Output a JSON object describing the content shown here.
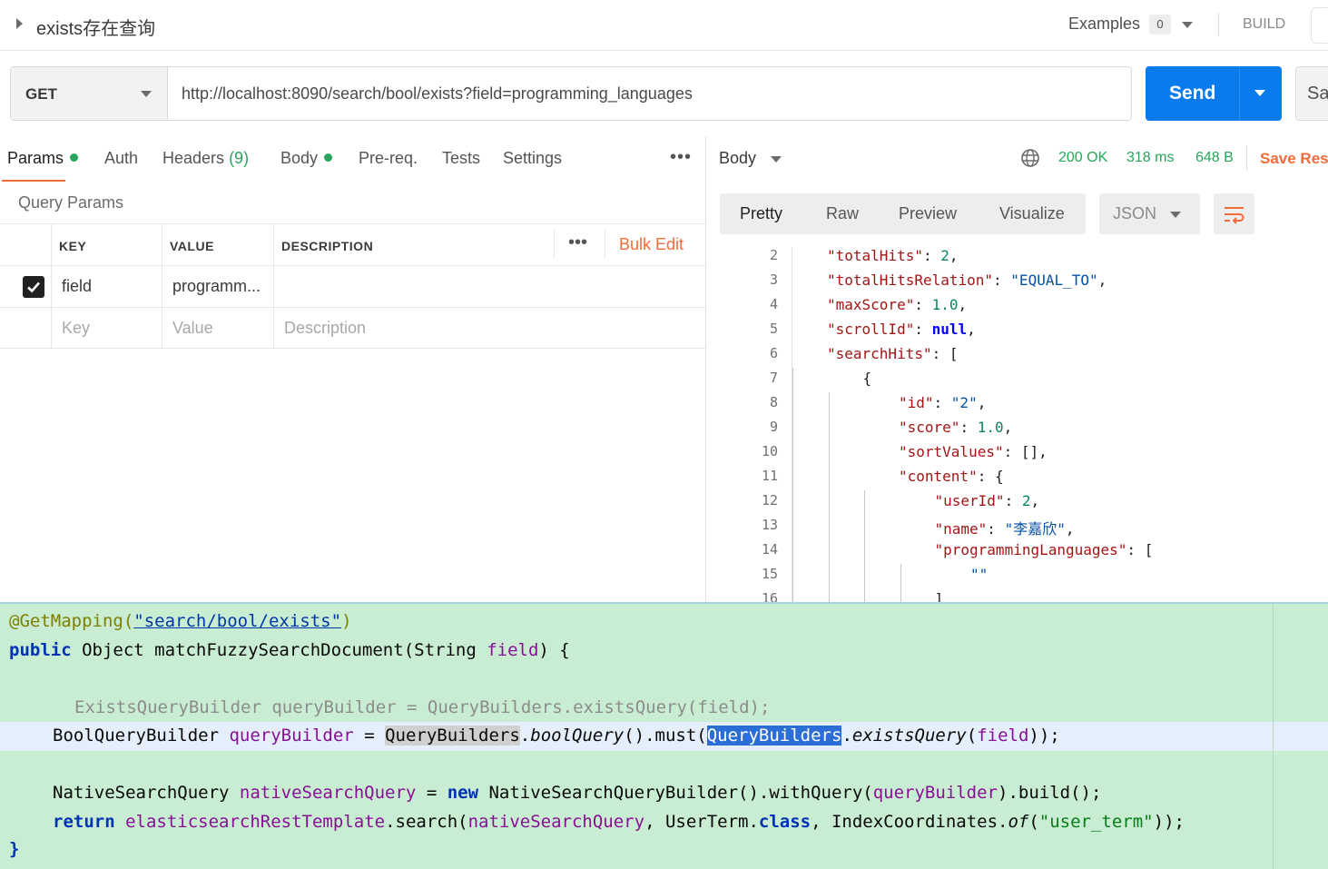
{
  "titlebar": {
    "request_name": "exists存在查询",
    "examples_label": "Examples",
    "examples_count": "0",
    "build_label": "BUILD"
  },
  "request": {
    "method": "GET",
    "url": "http://localhost:8090/search/bool/exists?field=programming_languages",
    "send_label": "Send",
    "save_label": "Sa"
  },
  "request_tabs": [
    {
      "label": "Params",
      "dot": true
    },
    {
      "label": "Auth"
    },
    {
      "label": "Headers",
      "count": "(9)"
    },
    {
      "label": "Body",
      "dot": true
    },
    {
      "label": "Pre-req."
    },
    {
      "label": "Tests"
    },
    {
      "label": "Settings"
    }
  ],
  "params": {
    "section_title": "Query Params",
    "columns": [
      "KEY",
      "VALUE",
      "DESCRIPTION"
    ],
    "bulk_edit_label": "Bulk Edit",
    "rows": [
      {
        "checked": true,
        "key": "field",
        "value": "programm...",
        "description": ""
      }
    ],
    "placeholder": {
      "key": "Key",
      "value": "Value",
      "description": "Description"
    }
  },
  "response": {
    "body_label": "Body",
    "status": "200 OK",
    "time": "318 ms",
    "size": "648 B",
    "save_response_label": "Save Res",
    "view_tabs": [
      "Pretty",
      "Raw",
      "Preview",
      "Visualize"
    ],
    "active_view": "Pretty",
    "format": "JSON",
    "lines": [
      {
        "n": "2",
        "indent": 1,
        "key": "\"totalHits\"",
        "sep": ": ",
        "val": "2",
        "vt": "n",
        "end": ","
      },
      {
        "n": "3",
        "indent": 1,
        "key": "\"totalHitsRelation\"",
        "sep": ": ",
        "val": "\"EQUAL_TO\"",
        "vt": "s",
        "end": ","
      },
      {
        "n": "4",
        "indent": 1,
        "key": "\"maxScore\"",
        "sep": ": ",
        "val": "1.0",
        "vt": "n",
        "end": ","
      },
      {
        "n": "5",
        "indent": 1,
        "key": "\"scrollId\"",
        "sep": ": ",
        "val": "null",
        "vt": "kw",
        "end": ","
      },
      {
        "n": "6",
        "indent": 1,
        "key": "\"searchHits\"",
        "sep": ": ",
        "val": "[",
        "vt": "p",
        "end": ""
      },
      {
        "n": "7",
        "indent": 2,
        "key": "",
        "sep": "",
        "val": "{",
        "vt": "p",
        "end": ""
      },
      {
        "n": "8",
        "indent": 3,
        "key": "\"id\"",
        "sep": ": ",
        "val": "\"2\"",
        "vt": "s",
        "end": ","
      },
      {
        "n": "9",
        "indent": 3,
        "key": "\"score\"",
        "sep": ": ",
        "val": "1.0",
        "vt": "n",
        "end": ","
      },
      {
        "n": "10",
        "indent": 3,
        "key": "\"sortValues\"",
        "sep": ": ",
        "val": "[]",
        "vt": "p",
        "end": ","
      },
      {
        "n": "11",
        "indent": 3,
        "key": "\"content\"",
        "sep": ": ",
        "val": "{",
        "vt": "p",
        "end": ""
      },
      {
        "n": "12",
        "indent": 4,
        "key": "\"userId\"",
        "sep": ": ",
        "val": "2",
        "vt": "n",
        "end": ","
      },
      {
        "n": "13",
        "indent": 4,
        "key": "\"name\"",
        "sep": ": ",
        "val": "\"李嘉欣\"",
        "vt": "s",
        "end": ","
      },
      {
        "n": "14",
        "indent": 4,
        "key": "\"programmingLanguages\"",
        "sep": ": ",
        "val": "[",
        "vt": "p",
        "end": ""
      },
      {
        "n": "15",
        "indent": 5,
        "key": "",
        "sep": "",
        "val": "\"\"",
        "vt": "s",
        "end": ""
      },
      {
        "n": "16",
        "indent": 4,
        "key": "",
        "sep": "",
        "val": "]",
        "vt": "p",
        "end": ""
      }
    ]
  },
  "editor": {
    "l1_ann": "@GetMapping(",
    "l1_str": "\"search/bool/exists\"",
    "l1_end": ")",
    "l2_kw": "public",
    "l2_rest": " Object matchFuzzySearchDocument(String ",
    "l2_param": "field",
    "l2_end": ") {",
    "l4_comment": "ExistsQueryBuilder queryBuilder = QueryBuilders.existsQuery(field);",
    "l5_type": "BoolQueryBuilder ",
    "l5_var": "queryBuilder",
    "l5_eq": " = ",
    "l5_ref": "QueryBuilders",
    "l5_dot": ".",
    "l5_m1": "boolQuery",
    "l5_mid": "().must(",
    "l5_sel": "QueryBuilders",
    "l5_dot2": ".",
    "l5_m2": "existsQuery",
    "l5_open": "(",
    "l5_arg": "field",
    "l5_end": "));",
    "l7_type": "NativeSearchQuery ",
    "l7_var": "nativeSearchQuery",
    "l7_eq": " = ",
    "l7_new": "new",
    "l7_rest": " NativeSearchQueryBuilder().withQuery(",
    "l7_arg": "queryBuilder",
    "l7_end": ").build();",
    "l8_kw": "return",
    "l8_field": "elasticsearchRestTemplate",
    "l8_mid": ".search(",
    "l8_arg": "nativeSearchQuery",
    "l8_mid2": ", UserTerm.",
    "l8_class": "class",
    "l8_mid3": ", IndexCoordinates.",
    "l8_of": "of",
    "l8_open": "(",
    "l8_str": "\"user_term\"",
    "l8_end": "));",
    "l9": "}"
  }
}
